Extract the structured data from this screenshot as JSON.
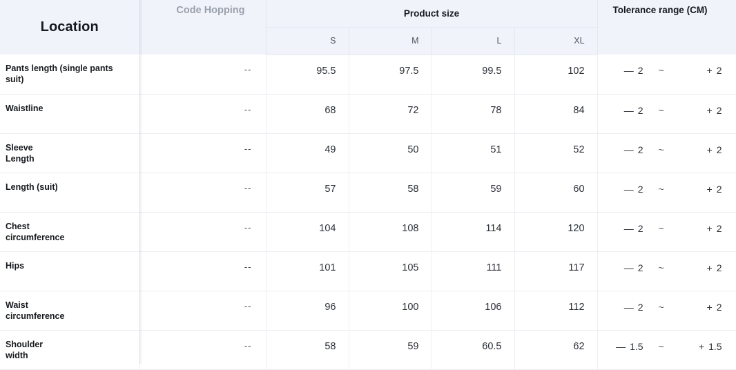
{
  "header": {
    "location": "Location",
    "code_hopping": "Code Hopping",
    "product_size": "Product size",
    "tolerance": "Tolerance range (CM)",
    "sizes": [
      "S",
      "M",
      "L",
      "XL"
    ]
  },
  "rows": [
    {
      "label": "Pants length (single pants suit)",
      "code": "--",
      "s": "95.5",
      "m": "97.5",
      "l": "99.5",
      "xl": "102",
      "tol_sign_low": "—",
      "tol_low": "2",
      "tol_mid": "~",
      "tol_sign_high": "+",
      "tol_high": "2"
    },
    {
      "label": "Waistline",
      "code": "--",
      "s": "68",
      "m": "72",
      "l": "78",
      "xl": "84",
      "tol_sign_low": "—",
      "tol_low": "2",
      "tol_mid": "~",
      "tol_sign_high": "+",
      "tol_high": "2"
    },
    {
      "label": "Sleeve\nLength",
      "code": "--",
      "s": "49",
      "m": "50",
      "l": "51",
      "xl": "52",
      "tol_sign_low": "—",
      "tol_low": "2",
      "tol_mid": "~",
      "tol_sign_high": "+",
      "tol_high": "2"
    },
    {
      "label": "Length (suit)",
      "code": "--",
      "s": "57",
      "m": "58",
      "l": "59",
      "xl": "60",
      "tol_sign_low": "—",
      "tol_low": "2",
      "tol_mid": "~",
      "tol_sign_high": "+",
      "tol_high": "2"
    },
    {
      "label": "Chest\ncircumference",
      "code": "--",
      "s": "104",
      "m": "108",
      "l": "114",
      "xl": "120",
      "tol_sign_low": "—",
      "tol_low": "2",
      "tol_mid": "~",
      "tol_sign_high": "+",
      "tol_high": "2"
    },
    {
      "label": "Hips",
      "code": "--",
      "s": "101",
      "m": "105",
      "l": "111",
      "xl": "117",
      "tol_sign_low": "—",
      "tol_low": "2",
      "tol_mid": "~",
      "tol_sign_high": "+",
      "tol_high": "2"
    },
    {
      "label": "Waist\ncircumference",
      "code": "--",
      "s": "96",
      "m": "100",
      "l": "106",
      "xl": "112",
      "tol_sign_low": "—",
      "tol_low": "2",
      "tol_mid": "~",
      "tol_sign_high": "+",
      "tol_high": "2"
    },
    {
      "label": "Shoulder\nwidth",
      "code": "--",
      "s": "58",
      "m": "59",
      "l": "60.5",
      "xl": "62",
      "tol_sign_low": "—",
      "tol_low": "1.5",
      "tol_mid": "~",
      "tol_sign_high": "+",
      "tol_high": "1.5"
    }
  ],
  "colors": {
    "header_bg": "#f0f3fa",
    "body_bg": "#ffffff",
    "border": "#ebedf1",
    "text": "#16191d",
    "muted": "#9aa0ab"
  }
}
